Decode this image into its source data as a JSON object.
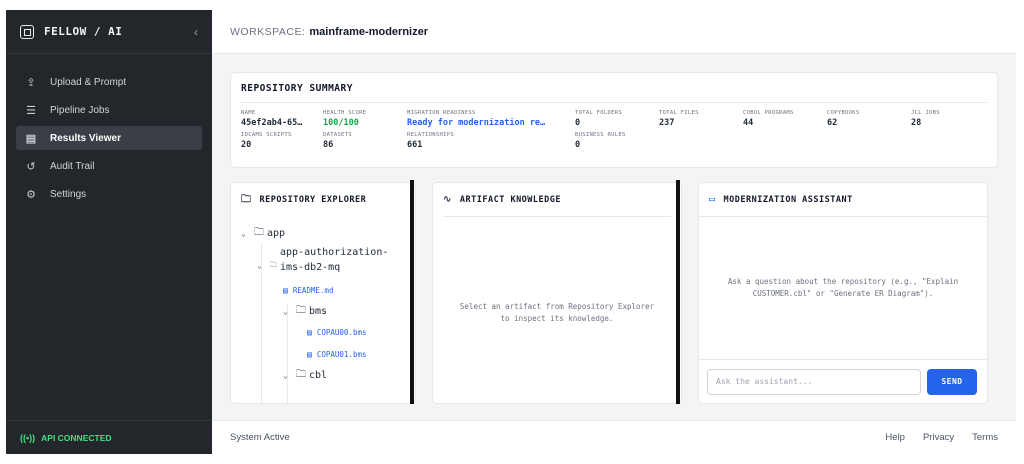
{
  "sidebar": {
    "brand": "FELLOW / AI",
    "collapse_icon": "chevron-left-icon",
    "items": [
      {
        "label": "Upload & Prompt",
        "icon": "upload-icon",
        "active": false
      },
      {
        "label": "Pipeline Jobs",
        "icon": "database-icon",
        "active": false
      },
      {
        "label": "Results Viewer",
        "icon": "document-icon",
        "active": true
      },
      {
        "label": "Audit Trail",
        "icon": "history-icon",
        "active": false
      },
      {
        "label": "Settings",
        "icon": "gear-icon",
        "active": false
      }
    ],
    "api_status": "API CONNECTED",
    "api_color": "#4ade80"
  },
  "header": {
    "workspace_label": "WORKSPACE:",
    "workspace_name": "mainframe-modernizer"
  },
  "summary": {
    "title": "REPOSITORY SUMMARY",
    "stats": [
      {
        "key": "NAME",
        "value": "45ef2ab4-65…"
      },
      {
        "key": "HEALTH SCORE",
        "value": "100/100"
      },
      {
        "key": "MIGRATION READINESS",
        "value": "Ready for modernization re…"
      },
      {
        "key": "TOTAL FOLDERS",
        "value": "0"
      },
      {
        "key": "TOTAL FILES",
        "value": "237"
      },
      {
        "key": "COBOL PROGRAMS",
        "value": "44"
      },
      {
        "key": "COPYBOOKS",
        "value": "62"
      },
      {
        "key": "JCL JOBS",
        "value": "28"
      },
      {
        "key": "IDCAMS SCRIPTS",
        "value": "20"
      },
      {
        "key": "DATASETS",
        "value": "86"
      },
      {
        "key": "RELATIONSHIPS",
        "value": "661"
      },
      {
        "key": "BUSINESS RULES",
        "value": "0"
      }
    ]
  },
  "explorer": {
    "title": "REPOSITORY EXPLORER",
    "tree": {
      "root": "app",
      "sub": "app-authorization-ims-db2-mq",
      "readme": "README.md",
      "bms": "bms",
      "bms_files": [
        "COPAU00.bms",
        "COPAU01.bms"
      ],
      "cbl": "cbl"
    }
  },
  "knowledge": {
    "title": "ARTIFACT KNOWLEDGE",
    "placeholder": "Select an artifact from Repository Explorer to inspect its knowledge."
  },
  "assistant": {
    "title": "MODERNIZATION ASSISTANT",
    "hint": "Ask a question about the repository (e.g., \"Explain CUSTOMER.cbl\" or \"Generate ER Diagram\").",
    "input_placeholder": "Ask the assistant...",
    "send_label": "SEND",
    "accent": "#2563eb"
  },
  "footer": {
    "status": "System Active",
    "links": [
      "Help",
      "Privacy",
      "Terms"
    ]
  }
}
